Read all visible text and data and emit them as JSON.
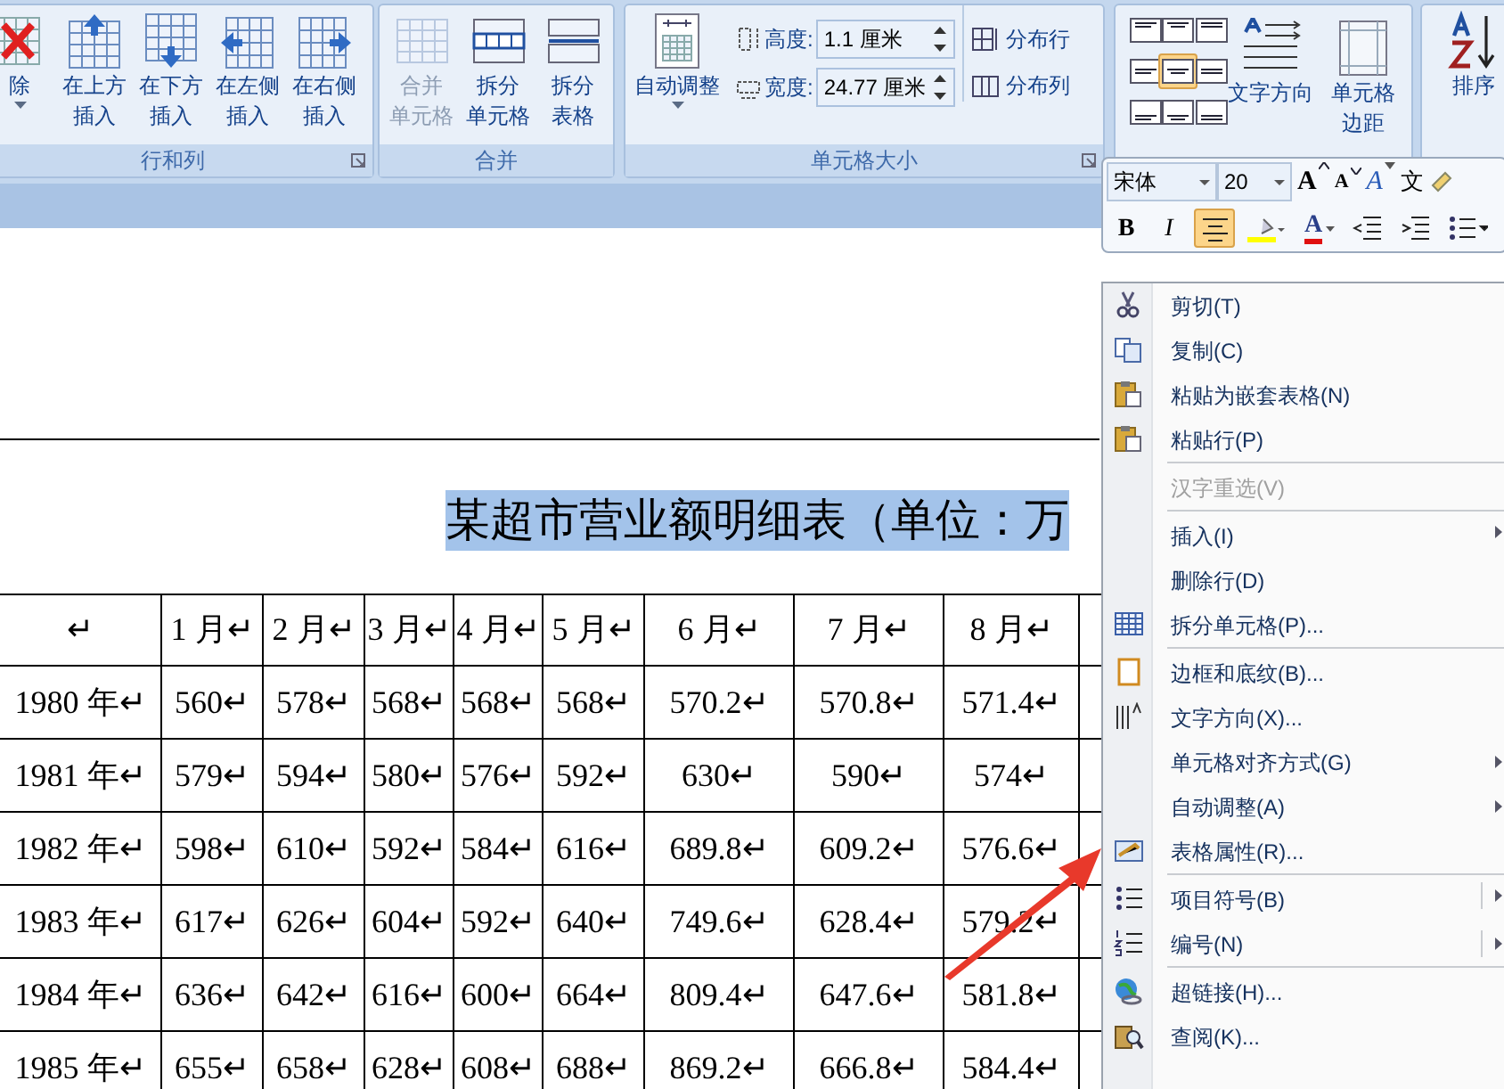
{
  "ribbon": {
    "groups": [
      {
        "kind": "big",
        "label": "行和列",
        "launcher": true,
        "buttons": [
          {
            "kind": "delete",
            "lines": [
              "除"
            ],
            "dropdown": true,
            "disabled": false
          },
          {
            "kind": "insert-above",
            "lines": [
              "在上方",
              "插入"
            ],
            "dropdown": false,
            "disabled": false
          },
          {
            "kind": "insert-below",
            "lines": [
              "在下方",
              "插入"
            ],
            "dropdown": false,
            "disabled": false
          },
          {
            "kind": "insert-left",
            "lines": [
              "在左侧",
              "插入"
            ],
            "dropdown": false,
            "disabled": false
          },
          {
            "kind": "insert-right",
            "lines": [
              "在右侧",
              "插入"
            ],
            "dropdown": false,
            "disabled": false
          }
        ]
      },
      {
        "kind": "big",
        "label": "合并",
        "launcher": false,
        "buttons": [
          {
            "kind": "merge",
            "lines": [
              "合并",
              "单元格"
            ],
            "dropdown": false,
            "disabled": true
          },
          {
            "kind": "split-cells",
            "lines": [
              "拆分",
              "单元格"
            ],
            "dropdown": false,
            "disabled": false
          },
          {
            "kind": "split-table",
            "lines": [
              "拆分",
              "表格"
            ],
            "dropdown": false,
            "disabled": false
          }
        ]
      },
      {
        "kind": "size",
        "label": "单元格大小",
        "launcher": true,
        "autofit": {
          "kind": "autofit",
          "lines": [
            "自动调整"
          ],
          "dropdown": true,
          "disabled": false
        },
        "fields": [
          {
            "label": "高度:",
            "value": "1.1 厘米"
          },
          {
            "label": "宽度:",
            "value": "24.77 厘米"
          }
        ],
        "distribute": [
          "分布行",
          "分布列"
        ]
      },
      {
        "kind": "align",
        "align_buttons": [
          {
            "selected": false
          },
          {
            "selected": false
          },
          {
            "selected": false
          },
          {
            "selected": false
          },
          {
            "selected": true
          },
          {
            "selected": false
          },
          {
            "selected": false
          },
          {
            "selected": false
          },
          {
            "selected": false
          }
        ],
        "buttons": [
          {
            "kind": "text-direction",
            "lines": [
              "文字方向"
            ],
            "dropdown": false,
            "disabled": false
          },
          {
            "kind": "cell-margins",
            "lines": [
              "单元格",
              "边距"
            ],
            "dropdown": false,
            "disabled": false
          }
        ]
      },
      {
        "kind": "big",
        "buttons": [
          {
            "kind": "sort",
            "lines": [
              "排序"
            ],
            "dropdown": false,
            "disabled": false
          }
        ]
      }
    ]
  },
  "mini_toolbar": {
    "font": "宋体",
    "size": "20",
    "row1": [
      {
        "kind": "grow",
        "glyph": "A"
      },
      {
        "kind": "shrink",
        "glyph": "A"
      },
      {
        "kind": "styles",
        "glyph": "A"
      },
      {
        "kind": "phonetic",
        "glyph": "文"
      },
      {
        "kind": "painter"
      }
    ],
    "row2": [
      {
        "kind": "bold",
        "glyph": "B",
        "selected": false
      },
      {
        "kind": "italic",
        "glyph": "I",
        "selected": false
      },
      {
        "kind": "center",
        "selected": true
      },
      {
        "kind": "highlight",
        "selected": false
      },
      {
        "kind": "font-color",
        "glyph": "A",
        "selected": false
      },
      {
        "kind": "outdent",
        "selected": false
      },
      {
        "kind": "indent",
        "selected": false
      },
      {
        "kind": "bullets",
        "selected": false
      }
    ]
  },
  "document": {
    "heading": "某超市营业额明细表（单位：万",
    "heading_selected": true,
    "table": {
      "columns": [
        "↵",
        "1 月↵",
        "2 月↵",
        "3 月↵",
        "4 月↵",
        "5 月↵",
        "6 月↵",
        "7 月↵",
        "8 月↵"
      ],
      "rows": [
        [
          "1980 年↵",
          "560↵",
          "578↵",
          "568↵",
          "568↵",
          "568↵",
          "570.2↵",
          "570.8↵",
          "571.4↵"
        ],
        [
          "1981 年↵",
          "579↵",
          "594↵",
          "580↵",
          "576↵",
          "592↵",
          "630↵",
          "590↵",
          "574↵"
        ],
        [
          "1982 年↵",
          "598↵",
          "610↵",
          "592↵",
          "584↵",
          "616↵",
          "689.8↵",
          "609.2↵",
          "576.6↵"
        ],
        [
          "1983 年↵",
          "617↵",
          "626↵",
          "604↵",
          "592↵",
          "640↵",
          "749.6↵",
          "628.4↵",
          "579.2↵"
        ],
        [
          "1984 年↵",
          "636↵",
          "642↵",
          "616↵",
          "600↵",
          "664↵",
          "809.4↵",
          "647.6↵",
          "581.8↵"
        ],
        [
          "1985 年↵",
          "655↵",
          "658↵",
          "628↵",
          "608↵",
          "688↵",
          "869.2↵",
          "666.8↵",
          "584.4↵"
        ]
      ]
    }
  },
  "context_menu": [
    {
      "label": "剪切(T)",
      "kind": "cut",
      "disabled": false,
      "separator_before": false,
      "submenu": false,
      "split": false
    },
    {
      "label": "复制(C)",
      "kind": "copy",
      "disabled": false,
      "separator_before": false,
      "submenu": false,
      "split": false
    },
    {
      "label": "粘贴为嵌套表格(N)",
      "kind": "paste",
      "disabled": false,
      "separator_before": false,
      "submenu": false,
      "split": false
    },
    {
      "label": "粘贴行(P)",
      "kind": "paste",
      "disabled": false,
      "separator_before": false,
      "submenu": false,
      "split": false
    },
    {
      "label": "汉字重选(V)",
      "kind": "plain",
      "disabled": true,
      "separator_before": true,
      "submenu": false,
      "split": false
    },
    {
      "label": "插入(I)",
      "kind": "plain",
      "disabled": false,
      "separator_before": true,
      "submenu": true,
      "split": false
    },
    {
      "label": "删除行(D)",
      "kind": "plain",
      "disabled": false,
      "separator_before": false,
      "submenu": false,
      "split": false
    },
    {
      "label": "拆分单元格(P)...",
      "kind": "grid",
      "disabled": false,
      "separator_before": false,
      "submenu": false,
      "split": false
    },
    {
      "label": "边框和底纹(B)...",
      "kind": "border",
      "disabled": false,
      "separator_before": true,
      "submenu": false,
      "split": false
    },
    {
      "label": "文字方向(X)...",
      "kind": "text-direction",
      "disabled": false,
      "separator_before": false,
      "submenu": false,
      "split": false
    },
    {
      "label": "单元格对齐方式(G)",
      "kind": "plain",
      "disabled": false,
      "separator_before": false,
      "submenu": true,
      "split": false
    },
    {
      "label": "自动调整(A)",
      "kind": "plain",
      "disabled": false,
      "separator_before": false,
      "submenu": true,
      "split": false
    },
    {
      "label": "表格属性(R)...",
      "kind": "table-properties",
      "disabled": false,
      "separator_before": false,
      "submenu": false,
      "split": false
    },
    {
      "label": "项目符号(B)",
      "kind": "bullets",
      "disabled": false,
      "separator_before": true,
      "submenu": true,
      "split": true
    },
    {
      "label": "编号(N)",
      "kind": "numbering",
      "disabled": false,
      "separator_before": false,
      "submenu": true,
      "split": true
    },
    {
      "label": "超链接(H)...",
      "kind": "globe",
      "disabled": false,
      "separator_before": true,
      "submenu": false,
      "split": false
    },
    {
      "label": "查阅(K)...",
      "kind": "research",
      "disabled": false,
      "separator_before": false,
      "submenu": false,
      "split": false
    }
  ]
}
